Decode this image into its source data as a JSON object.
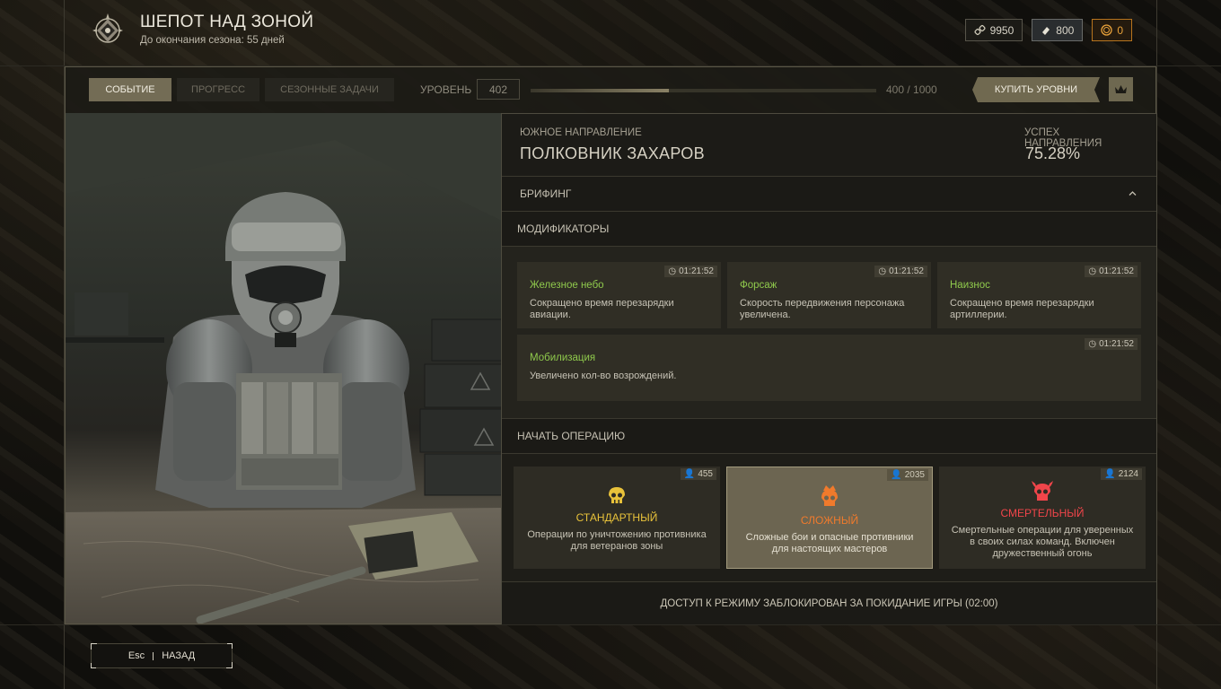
{
  "header": {
    "title": "ШЕПОТ НАД ЗОНОЙ",
    "subtitle": "До окончания сезона: 55 дней"
  },
  "currencies": [
    {
      "icon": "chain-icon",
      "value": "9950"
    },
    {
      "icon": "ticket-icon",
      "value": "800"
    },
    {
      "icon": "gold-coin-icon",
      "value": "0"
    }
  ],
  "tabs": [
    {
      "label": "СОБЫТИЕ",
      "active": true
    },
    {
      "label": "ПРОГРЕСС",
      "active": false
    },
    {
      "label": "СЕЗОННЫЕ ЗАДАЧИ",
      "active": false
    }
  ],
  "level": {
    "label": "УРОВЕНЬ",
    "value": "402",
    "progress_text": "400 / 1000",
    "progress_fraction": 0.4
  },
  "buy_levels_label": "КУПИТЬ УРОВНИ",
  "direction": {
    "label": "ЮЖНОЕ НАПРАВЛЕНИЕ",
    "name": "ПОЛКОВНИК ЗАХАРОВ",
    "success_label": "УСПЕХ НАПРАВЛЕНИЯ",
    "success_value": "75.28%"
  },
  "briefing_label": "БРИФИНГ",
  "modifiers_label": "МОДИФИКАТОРЫ",
  "modifiers": [
    {
      "title": "Железное небо",
      "desc": "Сокращено время перезарядки авиации.",
      "timer": "01:21:52"
    },
    {
      "title": "Форсаж",
      "desc": "Скорость передвижения персонажа увеличена.",
      "timer": "01:21:52"
    },
    {
      "title": "Наизнос",
      "desc": "Сокращено время перезарядки артиллерии.",
      "timer": "01:21:52"
    },
    {
      "title": "Мобилизация",
      "desc": "Увеличено кол-во возрождений.",
      "timer": "01:21:52"
    }
  ],
  "start_operation_label": "НАЧАТЬ ОПЕРАЦИЮ",
  "operations": [
    {
      "title": "СТАНДАРТНЫЙ",
      "desc": "Операции по уничтожению противника для ветеранов зоны",
      "count": "455",
      "color": "#e8c23a",
      "icon": "skull-icon",
      "selected": false
    },
    {
      "title": "СЛОЖНЫЙ",
      "desc": "Сложные бои и опасные противники для настоящих мастеров",
      "count": "2035",
      "color": "#f07a2c",
      "icon": "crowned-skull-icon",
      "selected": true
    },
    {
      "title": "СМЕРТЕЛЬНЫЙ",
      "desc": "Смертельные операции для уверенных в своих силах команд. Включен дружественный огонь",
      "count": "2124",
      "color": "#f0454a",
      "icon": "horned-skull-icon",
      "selected": false
    }
  ],
  "locked_message": "ДОСТУП К РЕЖИМУ ЗАБЛОКИРОВАН ЗА ПОКИДАНИЕ ИГРЫ (02:00)",
  "back": {
    "key": "Esc",
    "label": "НАЗАД"
  }
}
